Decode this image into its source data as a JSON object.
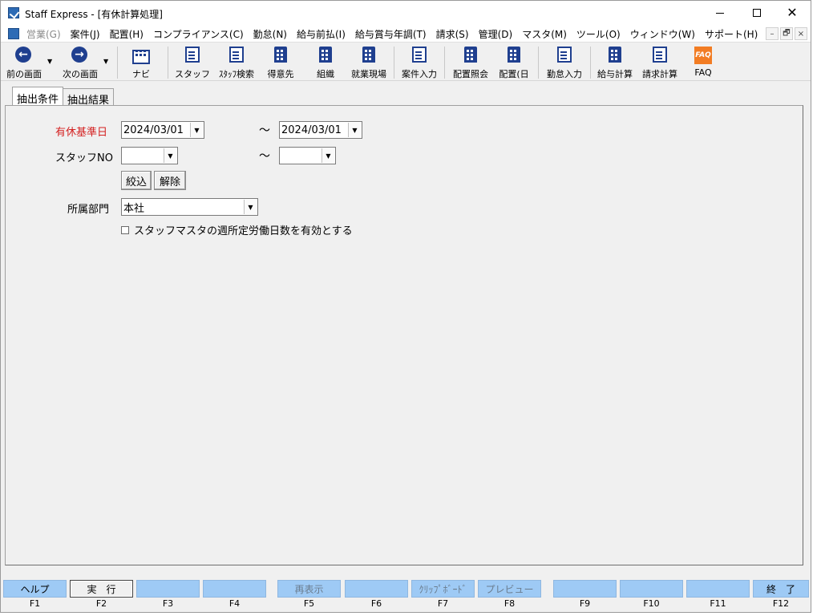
{
  "window": {
    "title": "Staff Express - [有休計算処理]",
    "accent_color": "#1f3f8f",
    "required_color": "#d42121",
    "fkey_color": "#9ecaf5"
  },
  "menu": {
    "items": [
      {
        "label": "営業(G)",
        "disabled": true
      },
      {
        "label": "案件(J)",
        "disabled": false
      },
      {
        "label": "配置(H)",
        "disabled": false
      },
      {
        "label": "コンプライアンス(C)",
        "disabled": false
      },
      {
        "label": "勤怠(N)",
        "disabled": false
      },
      {
        "label": "給与前払(I)",
        "disabled": false
      },
      {
        "label": "給与賞与年調(T)",
        "disabled": false
      },
      {
        "label": "請求(S)",
        "disabled": false
      },
      {
        "label": "管理(D)",
        "disabled": false
      },
      {
        "label": "マスタ(M)",
        "disabled": false
      },
      {
        "label": "ツール(O)",
        "disabled": false
      },
      {
        "label": "ウィンドウ(W)",
        "disabled": false
      },
      {
        "label": "サポート(H)",
        "disabled": false
      }
    ],
    "mdi_minimize": "–",
    "mdi_restore": "🗗",
    "mdi_close": "×"
  },
  "toolbar": {
    "back": {
      "label": "前の画面",
      "icon": "arrow-left-icon"
    },
    "forward": {
      "label": "次の画面",
      "icon": "arrow-right-icon"
    },
    "navi": {
      "label": "ナビ",
      "icon": "navi-icon"
    },
    "staff": {
      "label": "スタッフ",
      "icon": "staff-icon"
    },
    "staff_search": {
      "label": "ｽﾀｯﾌ検索",
      "icon": "staff-search-icon"
    },
    "customer": {
      "label": "得意先",
      "icon": "customer-icon"
    },
    "organization": {
      "label": "組織",
      "icon": "organization-icon"
    },
    "worksite": {
      "label": "就業現場",
      "icon": "worksite-icon"
    },
    "case_entry": {
      "label": "案件入力",
      "icon": "case-entry-icon"
    },
    "assignment_inquiry": {
      "label": "配置照会",
      "icon": "assignment-inquiry-icon"
    },
    "assignment_day": {
      "label": "配置(日",
      "icon": "assignment-day-icon"
    },
    "attendance_entry": {
      "label": "勤怠入力",
      "icon": "attendance-entry-icon"
    },
    "payroll": {
      "label": "給与計算",
      "icon": "payroll-icon"
    },
    "billing": {
      "label": "請求計算",
      "icon": "billing-icon"
    },
    "faq": {
      "label": "FAQ",
      "icon": "faq-icon",
      "icon_text": "FAQ"
    }
  },
  "tabs": [
    {
      "label": "抽出条件",
      "active": true
    },
    {
      "label": "抽出結果",
      "active": false
    }
  ],
  "form": {
    "leave_base_date": {
      "label": "有休基準日",
      "from": "2024/03/01",
      "to": "2024/03/01"
    },
    "staff_no": {
      "label": "スタッフNO",
      "from": "",
      "to": ""
    },
    "range_separator": "～",
    "filter_button": "絞込",
    "clear_button": "解除",
    "department": {
      "label": "所属部門",
      "value": "本社"
    },
    "weekly_days_checkbox": {
      "label": "スタッフマスタの週所定労働日数を有効とする",
      "checked": false
    }
  },
  "function_keys": [
    {
      "key": "F1",
      "label": "ヘルプ"
    },
    {
      "key": "F2",
      "label": "実　行"
    },
    {
      "key": "F3",
      "label": ""
    },
    {
      "key": "F4",
      "label": ""
    },
    {
      "key": "F5",
      "label": "再表示"
    },
    {
      "key": "F6",
      "label": ""
    },
    {
      "key": "F7",
      "label": "ｸﾘｯﾌﾟﾎﾞｰﾄﾞ"
    },
    {
      "key": "F8",
      "label": "プレビュー"
    },
    {
      "key": "F9",
      "label": ""
    },
    {
      "key": "F10",
      "label": ""
    },
    {
      "key": "F11",
      "label": ""
    },
    {
      "key": "F12",
      "label": "終　了"
    }
  ]
}
